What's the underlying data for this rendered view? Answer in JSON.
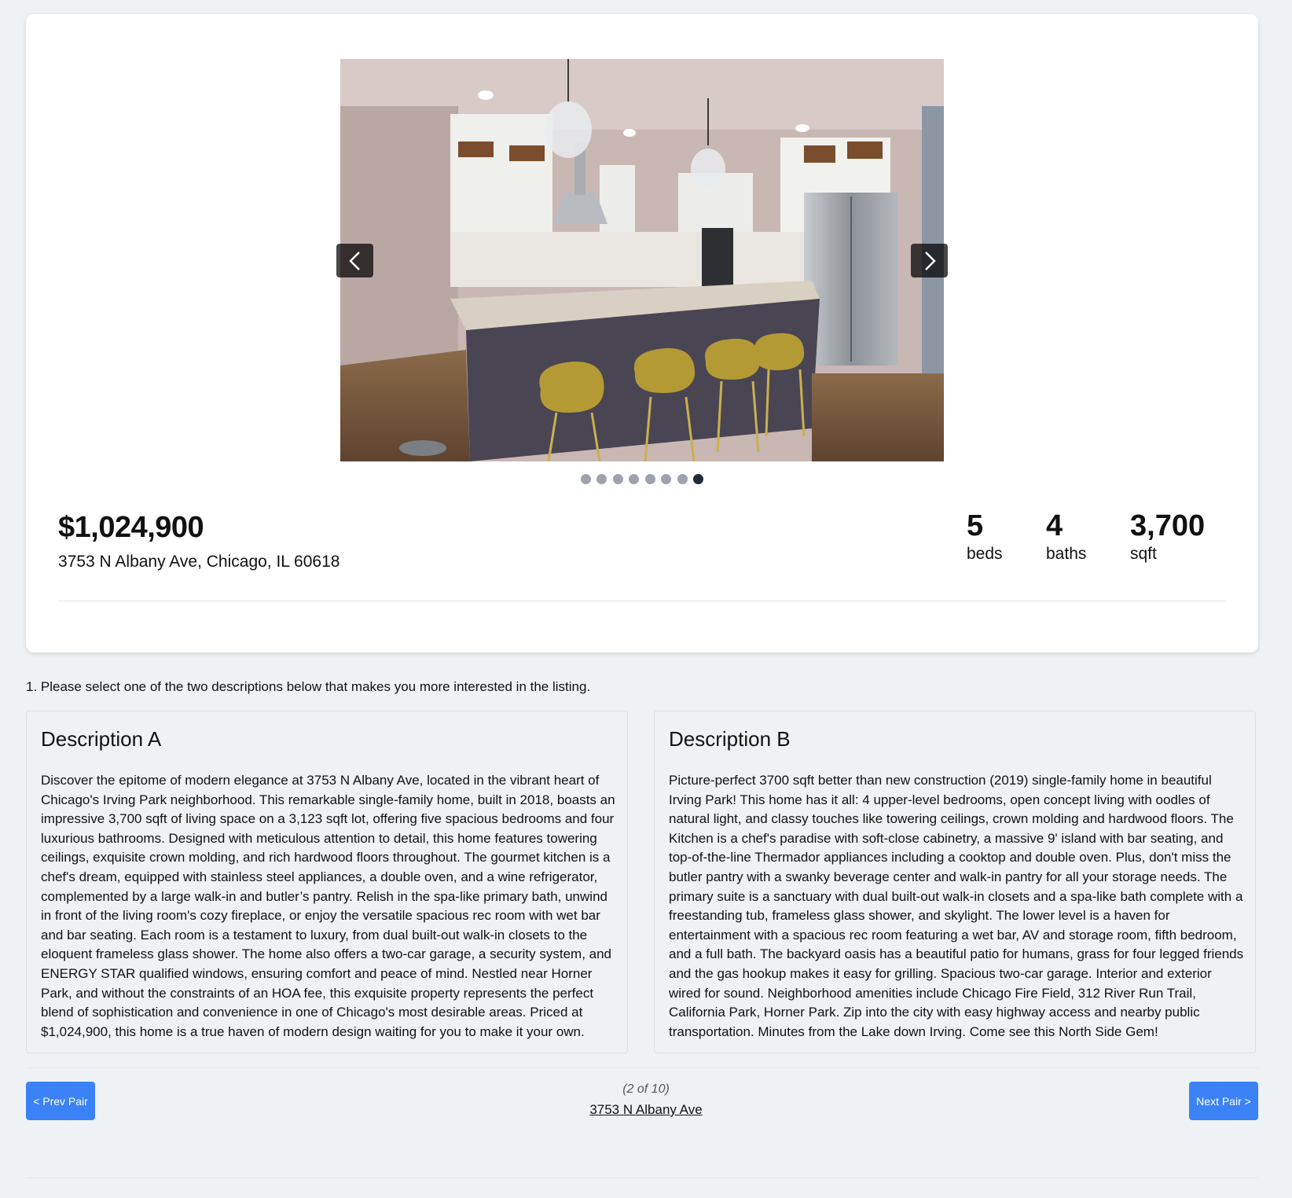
{
  "listing": {
    "price": "$1,024,900",
    "address": "3753 N Albany Ave, Chicago, IL 60618",
    "stats": [
      {
        "value": "5",
        "label": "beds"
      },
      {
        "value": "4",
        "label": "baths"
      },
      {
        "value": "3,700",
        "label": "sqft"
      }
    ]
  },
  "gallery": {
    "photo_count": 8,
    "active_index": 7,
    "prev_icon": "chevron-left-icon",
    "next_icon": "chevron-right-icon"
  },
  "question": "1. Please select one of the two descriptions below that makes you more interested in the listing.",
  "descriptions": [
    {
      "title": "Description A",
      "text": "Discover the epitome of modern elegance at 3753 N Albany Ave, located in the vibrant heart of Chicago's Irving Park neighborhood. This remarkable single-family home, built in 2018, boasts an impressive 3,700 sqft of living space on a 3,123 sqft lot, offering five spacious bedrooms and four luxurious bathrooms. Designed with meticulous attention to detail, this home features towering ceilings, exquisite crown molding, and rich hardwood floors throughout. The gourmet kitchen is a chef's dream, equipped with stainless steel appliances, a double oven, and a wine refrigerator, complemented by a large walk-in and butler’s pantry. Relish in the spa-like primary bath, unwind in front of the living room's cozy fireplace, or enjoy the versatile spacious rec room with wet bar and bar seating. Each room is a testament to luxury, from dual built-out walk-in closets to the eloquent frameless glass shower. The home also offers a two-car garage, a security system, and ENERGY STAR qualified windows, ensuring comfort and peace of mind. Nestled near Horner Park, and without the constraints of an HOA fee, this exquisite property represents the perfect blend of sophistication and convenience in one of Chicago's most desirable areas. Priced at $1,024,900, this home is a true haven of modern design waiting for you to make it your own."
    },
    {
      "title": "Description B",
      "text": "Picture-perfect 3700 sqft better than new construction (2019) single-family home in beautiful Irving Park! This home has it all: 4 upper-level bedrooms, open concept living with oodles of natural light, and classy touches like towering ceilings, crown molding and hardwood floors. The Kitchen is a chef's paradise with soft-close cabinetry, a massive 9' island with bar seating, and top-of-the-line Thermador appliances including a cooktop and double oven. Plus, don't miss the butler pantry with a swanky beverage center and walk-in pantry for all your storage needs. The primary suite is a sanctuary with dual built-out walk-in closets and a spa-like bath complete with a freestanding tub, frameless glass shower, and skylight. The lower level is a haven for entertainment with a spacious rec room featuring a wet bar, AV and storage room, fifth bedroom, and a full bath. The backyard oasis has a beautiful patio for humans, grass for four legged friends and the gas hookup makes it easy for grilling. Spacious two-car garage. Interior and exterior wired for sound. Neighborhood amenities include Chicago Fire Field, 312 River Run Trail, California Park, Horner Park. Zip into the city with easy highway access and nearby public transportation. Minutes from the Lake down Irving. Come see this North Side Gem!"
    }
  ],
  "pager": {
    "prev_label": "< Prev Pair",
    "next_label": "Next Pair >",
    "counter": "(2 of 10)",
    "current_link": "3753 N Albany Ave"
  },
  "colors": {
    "accent": "#3b82f6",
    "page_bg": "#eff2f5",
    "dot_inactive": "#9ca3af",
    "dot_active": "#1f2937"
  }
}
